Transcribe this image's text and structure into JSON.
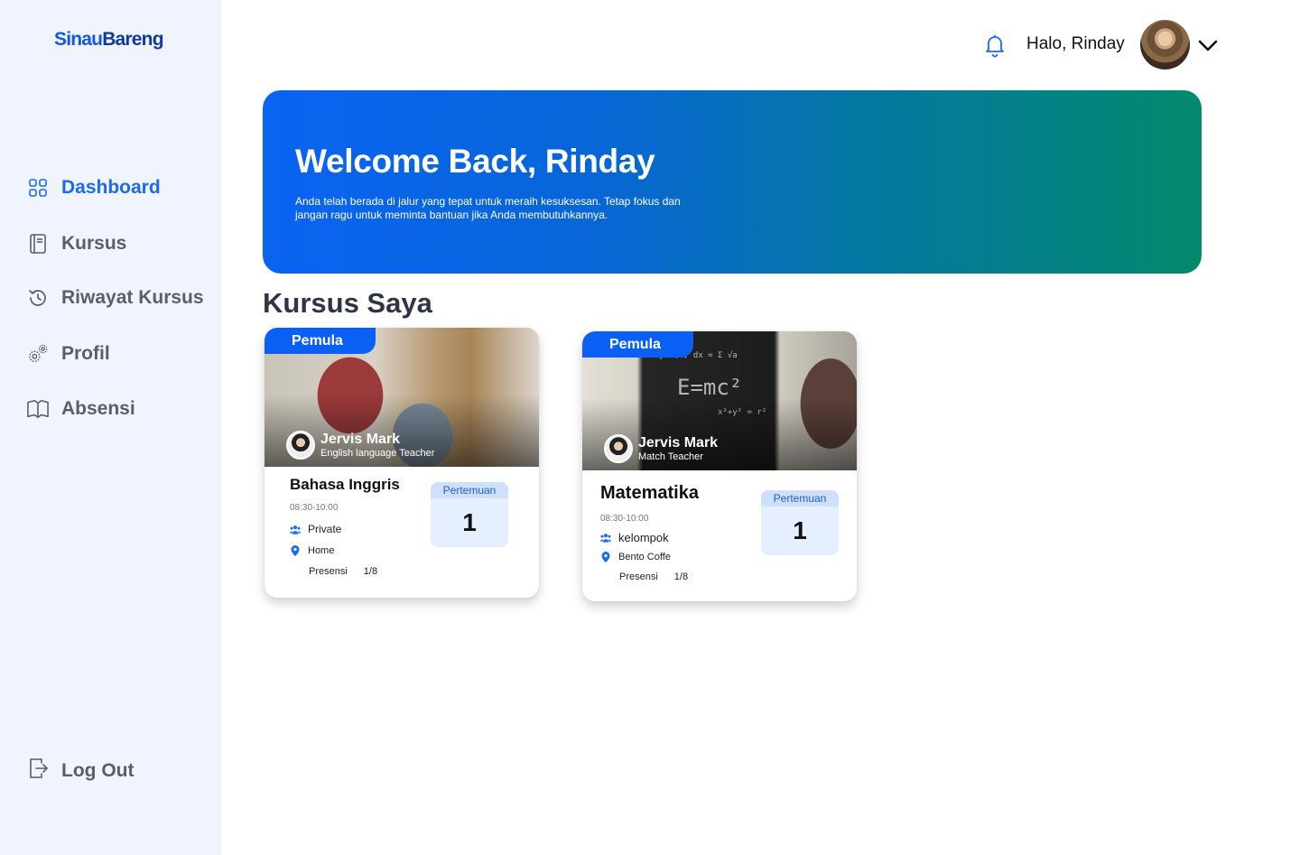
{
  "brand": {
    "part1": "Sinau",
    "part2": "Bareng"
  },
  "sidebar": {
    "items": [
      {
        "label": "Dashboard",
        "icon": "grid-icon",
        "active": true
      },
      {
        "label": "Kursus",
        "icon": "book-icon",
        "active": false
      },
      {
        "label": "Riwayat Kursus",
        "icon": "history-icon",
        "active": false
      },
      {
        "label": "Profil",
        "icon": "gears-icon",
        "active": false
      },
      {
        "label": "Absensi",
        "icon": "open-book-icon",
        "active": false
      }
    ],
    "logout_label": "Log Out"
  },
  "header": {
    "greeting": "Halo, Rinday"
  },
  "hero": {
    "title": "Welcome Back, Rinday",
    "subtitle": "Anda telah berada di jalur yang tepat untuk meraih kesuksesan. Tetap fokus dan jangan ragu untuk meminta bantuan jika Anda membutuhkannya."
  },
  "section_title": "Kursus Saya",
  "courses": [
    {
      "level": "Pemula",
      "teacher_name": "Jervis Mark",
      "teacher_role": "English language Teacher",
      "title": "Bahasa Inggris",
      "time": "08:30-10:00",
      "type": "Private",
      "location": "Home",
      "presensi_label": "Presensi",
      "presensi_value": "1/8",
      "meeting_label": "Pertemuan",
      "meeting_value": "1"
    },
    {
      "level": "Pemula",
      "teacher_name": "Jervis Mark",
      "teacher_role": "Match Teacher",
      "title": "Matematika",
      "time": "08:30-10:00",
      "type": "kelompok",
      "location": "Bento Coffe",
      "presensi_label": "Presensi",
      "presensi_value": "1/8",
      "meeting_label": "Pertemuan",
      "meeting_value": "1"
    }
  ],
  "colors": {
    "accent": "#1a6bf0",
    "sidebar_bg": "#eff4fe",
    "badge": "#0a5ff5"
  }
}
